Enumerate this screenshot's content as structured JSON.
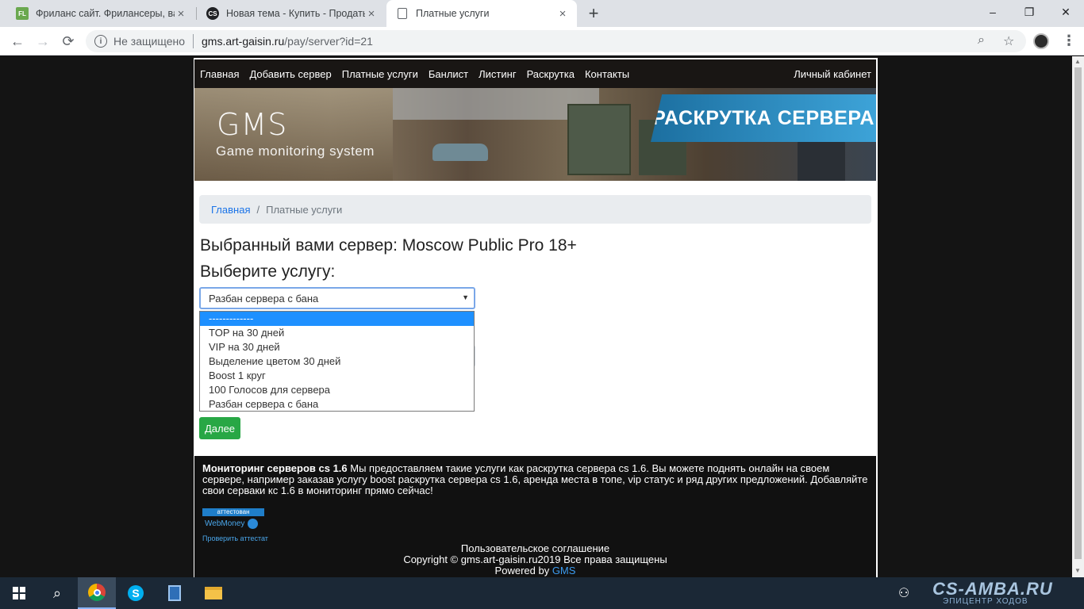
{
  "browser": {
    "tabs": [
      {
        "title": "Фриланс сайт. Фрилансеры, вак",
        "favicon": "FL",
        "favicon_color": "#6aa84f"
      },
      {
        "title": "Новая тема - Купить - Продать",
        "favicon": "CS",
        "favicon_color": "#202124"
      },
      {
        "title": "Платные услуги",
        "favicon": "",
        "favicon_color": "#ffffff"
      }
    ],
    "new_tab_glyph": "+",
    "window_controls": {
      "minimize": "–",
      "maximize": "❐",
      "close": "✕"
    },
    "nav": {
      "back": "←",
      "forward": "→",
      "reload": "⟳"
    },
    "address": {
      "security_label": "Не защищено",
      "host": "gms.art-gaisin.ru",
      "path": "/pay/server?id=21"
    }
  },
  "site": {
    "menu": [
      "Главная",
      "Добавить сервер",
      "Платные услуги",
      "Банлист",
      "Листинг",
      "Раскрутка",
      "Контакты"
    ],
    "cabinet": "Личный кабинет",
    "logo_title": "GMS",
    "logo_subtitle": "Game monitoring system",
    "promo": "РАСКРУТКА СЕРВЕРА",
    "breadcrumb": {
      "home": "Главная",
      "separator": "/",
      "current": "Платные услуги"
    },
    "server_heading": "Выбранный вами сервер: Moscow Public Pro 18+",
    "choose_heading": "Выберите услугу:",
    "select_value": "Разбан сервера с бана",
    "select_arrow": "▼",
    "options": [
      "-------------",
      "TOP на 30 дней",
      "VIP на 30 дней",
      "Выделение цветом 30 дней",
      "Boost 1 круг",
      "100 Голосов для сервера",
      "Разбан сервера с бана"
    ],
    "selected_option_index": 0,
    "next_button": "Далее",
    "footer": {
      "lead_bold": "Мониторинг серверов cs 1.6",
      "lead_text": " Мы предоставляем такие услуги как раскрутка сервера cs 1.6. Вы можете поднять онлайн на своем сервере, например заказав услугу boost раскрутка сервера cs 1.6, аренда места в топе, vip статус и ряд других предложений. Добавляйте свои серваки кс 1.6 в мониторинг прямо сейчас!",
      "wm_top": "аттестован",
      "wm_bottom": "WebMoney",
      "wm_check": "Проверить аттестат",
      "agreement": "Пользовательское соглашение",
      "copyright": "Copyright © gms.art-gaisin.ru2019 Все права защищены",
      "powered_prefix": "Powered by ",
      "powered_link": "GMS"
    }
  },
  "taskbar": {
    "watermark": "CS-AMBA.RU",
    "watermark_sub": "ЭПИЦЕНТР ХОДОВ"
  },
  "colors": {
    "accent_blue": "#1e90ff",
    "button_green": "#28a745",
    "link_blue": "#1a73e8",
    "promo_blue": "#2a8ac4"
  }
}
